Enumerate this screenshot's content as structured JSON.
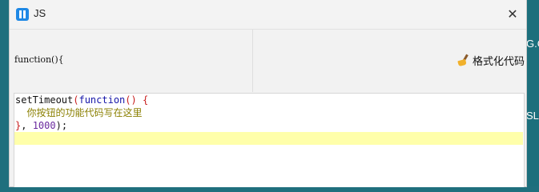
{
  "window": {
    "title": "JS",
    "close_glyph": "✕",
    "icon": "app-icon"
  },
  "background": {
    "right_text_1": "G.C",
    "right_text_2": "SL"
  },
  "header": {
    "function_label": "function(){",
    "format_button_label": "格式化代码",
    "format_icon": "broom-icon"
  },
  "editor": {
    "lines": [
      {
        "a": "setTimeout",
        "b": "(",
        "c": "function",
        "d": "() {"
      },
      {
        "comment": "  你按钮的功能代码写在这里"
      },
      {
        "a": "}",
        "b": ", ",
        "c": "1000",
        "d": ");"
      },
      {
        "active": true
      }
    ],
    "colors": {
      "keyword": "#1515a8",
      "bracket": "#c81e1e",
      "number": "#6a2a9e",
      "comment": "#8a7f00",
      "active_line": "#ffffaa"
    }
  }
}
